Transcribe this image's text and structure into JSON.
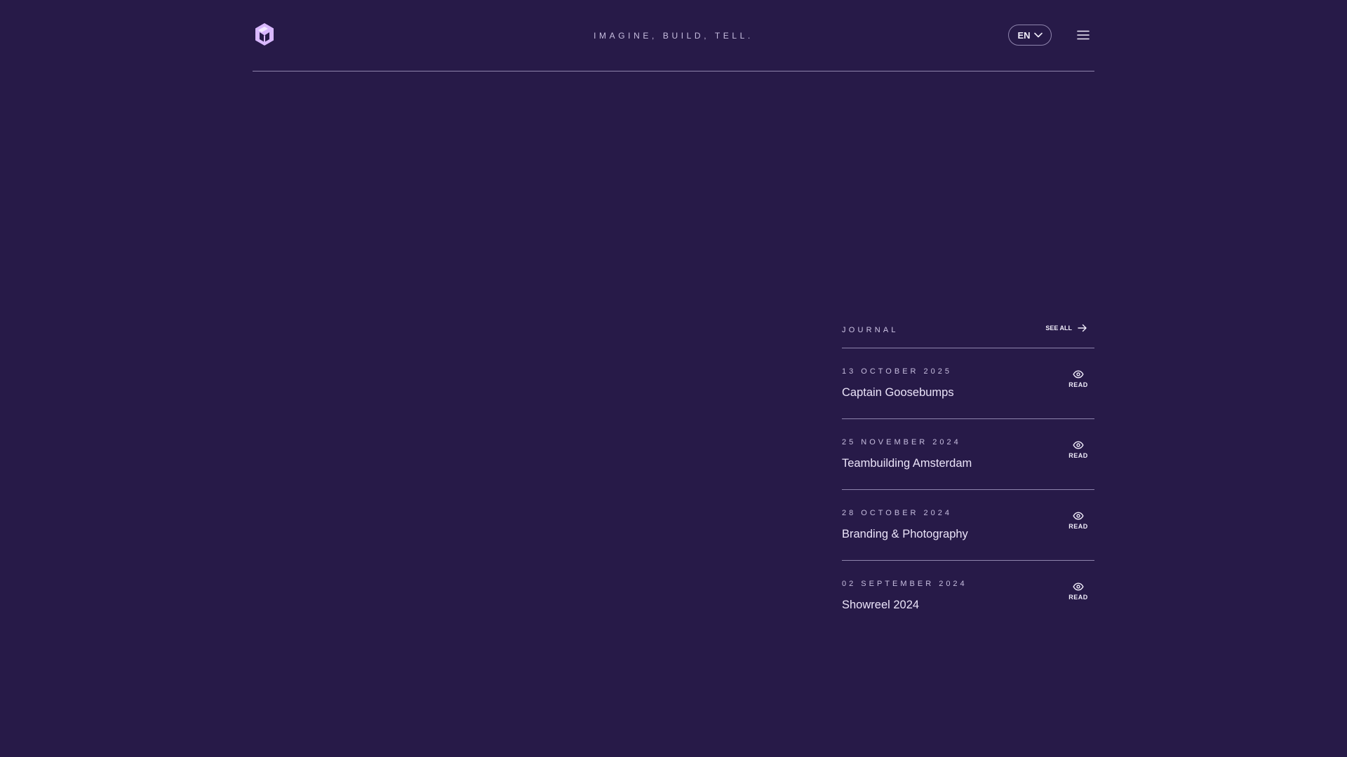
{
  "header": {
    "tagline": "IMAGINE, BUILD, TELL.",
    "language": "EN",
    "logo_icon": "hexagon-logo-icon",
    "menu_icon": "hamburger-menu-icon"
  },
  "journal": {
    "title": "JOURNAL",
    "see_all": "SEE ALL",
    "items": [
      {
        "date": "13 OCTOBER 2025",
        "title": "Captain Goosebumps",
        "read": "READ"
      },
      {
        "date": "25 NOVEMBER 2024",
        "title": "Teambuilding Amsterdam",
        "read": "READ"
      },
      {
        "date": "28 OCTOBER 2024",
        "title": "Branding & Photography",
        "read": "READ"
      },
      {
        "date": "02 SEPTEMBER 2024",
        "title": "Showreel 2024",
        "read": "READ"
      }
    ]
  },
  "colors": {
    "background": "#271a48",
    "accent": "#d9b8ff",
    "divider": "#8f85ad",
    "text": "#ebe4f9"
  }
}
